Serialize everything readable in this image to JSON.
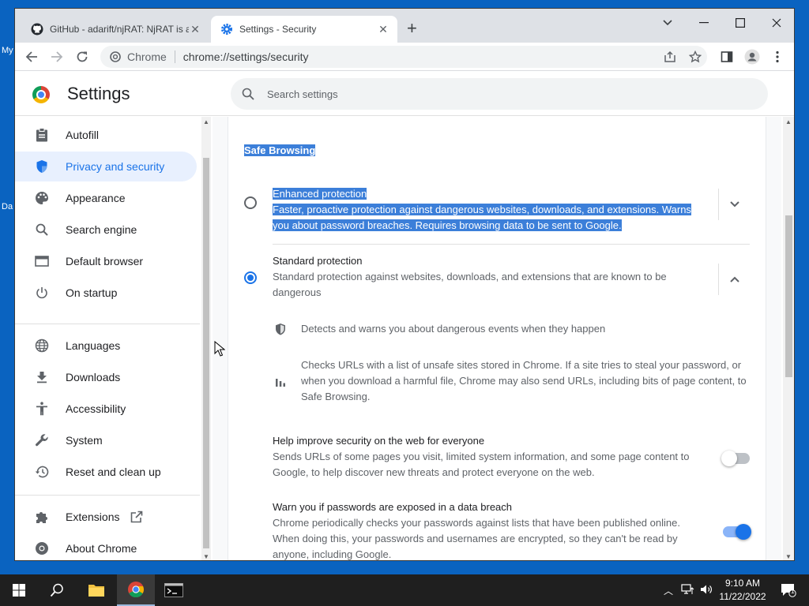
{
  "desktop": {
    "labels": [
      "My",
      "Da"
    ]
  },
  "tabs": [
    {
      "title": "GitHub - adarift/njRAT: NjRAT is a",
      "icon": "github-icon",
      "active": false
    },
    {
      "title": "Settings - Security",
      "icon": "gear-icon",
      "active": true
    }
  ],
  "toolbar": {
    "chip": "Chrome",
    "url": "chrome://settings/security"
  },
  "settings": {
    "title": "Settings",
    "search_placeholder": "Search settings"
  },
  "sidebar": {
    "items": [
      {
        "label": "Autofill",
        "icon": "clipboard-icon"
      },
      {
        "label": "Privacy and security",
        "icon": "shield-icon",
        "selected": true
      },
      {
        "label": "Appearance",
        "icon": "palette-icon"
      },
      {
        "label": "Search engine",
        "icon": "search-icon"
      },
      {
        "label": "Default browser",
        "icon": "browser-icon"
      },
      {
        "label": "On startup",
        "icon": "power-icon"
      },
      {
        "label": "Languages",
        "icon": "globe-icon"
      },
      {
        "label": "Downloads",
        "icon": "download-icon"
      },
      {
        "label": "Accessibility",
        "icon": "accessibility-icon"
      },
      {
        "label": "System",
        "icon": "wrench-icon"
      },
      {
        "label": "Reset and clean up",
        "icon": "history-icon"
      },
      {
        "label": "Extensions",
        "icon": "puzzle-icon"
      },
      {
        "label": "About Chrome",
        "icon": "chrome-icon"
      }
    ]
  },
  "main": {
    "section_title": "Safe Browsing",
    "enhanced": {
      "label": "Enhanced protection",
      "description": "Faster, proactive protection against dangerous websites, downloads, and extensions. Warns you about password breaches. Requires browsing data to be sent to Google.",
      "selected": false
    },
    "standard": {
      "label": "Standard protection",
      "description": "Standard protection against websites, downloads, and extensions that are known to be dangerous",
      "selected": true,
      "details": [
        {
          "icon": "shield-icon",
          "text": "Detects and warns you about dangerous events when they happen"
        },
        {
          "icon": "bar-chart-icon",
          "text": "Checks URLs with a list of unsafe sites stored in Chrome. If a site tries to steal your password, or when you download a harmful file, Chrome may also send URLs, including bits of page content, to Safe Browsing."
        }
      ]
    },
    "help_improve": {
      "label": "Help improve security on the web for everyone",
      "description": "Sends URLs of some pages you visit, limited system information, and some page content to Google, to help discover new threats and protect everyone on the web.",
      "enabled": false
    },
    "password_warn": {
      "label": "Warn you if passwords are exposed in a data breach",
      "description": "Chrome periodically checks your passwords against lists that have been published online. When doing this, your passwords and usernames are encrypted, so they can't be read by anyone, including Google.",
      "enabled": true
    }
  },
  "taskbar": {
    "time": "9:10 AM",
    "date": "11/22/2022",
    "notification_count": "1"
  },
  "colors": {
    "accent": "#1a73e8",
    "selected_nav_bg": "#e8f0fe",
    "text_highlight": "#3c7fd9",
    "desktop": "#0a63c0"
  }
}
